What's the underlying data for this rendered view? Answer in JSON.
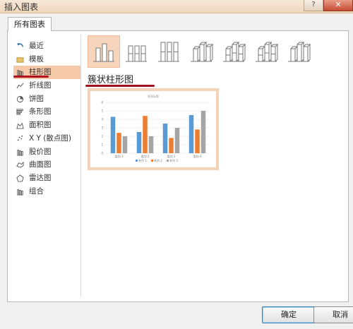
{
  "window": {
    "title": "插入图表",
    "help": "?",
    "close": "✕"
  },
  "tab_label": "所有图表",
  "sidebar": {
    "items": [
      {
        "label": "最近",
        "icon": "undo-icon"
      },
      {
        "label": "模板",
        "icon": "folder-icon"
      },
      {
        "label": "柱形图",
        "icon": "column-chart-icon",
        "selected": true
      },
      {
        "label": "折线图",
        "icon": "line-chart-icon"
      },
      {
        "label": "饼图",
        "icon": "pie-chart-icon"
      },
      {
        "label": "条形图",
        "icon": "bar-chart-icon"
      },
      {
        "label": "面积图",
        "icon": "area-chart-icon"
      },
      {
        "label": "X Y (散点图)",
        "icon": "scatter-chart-icon"
      },
      {
        "label": "股价图",
        "icon": "stock-chart-icon"
      },
      {
        "label": "曲面图",
        "icon": "surface-chart-icon"
      },
      {
        "label": "雷达图",
        "icon": "radar-chart-icon"
      },
      {
        "label": "组合",
        "icon": "combo-chart-icon"
      }
    ]
  },
  "subtypes": [
    {
      "icon": "clustered-column-icon",
      "selected": true
    },
    {
      "icon": "stacked-column-icon"
    },
    {
      "icon": "100-stacked-column-icon"
    },
    {
      "icon": "3d-clustered-column-icon"
    },
    {
      "icon": "3d-stacked-column-icon"
    },
    {
      "icon": "3d-100-stacked-column-icon"
    },
    {
      "icon": "3d-column-icon"
    }
  ],
  "subtype_name": "簇状柱形图",
  "chart_data": {
    "type": "bar",
    "title": "图表标题",
    "categories": [
      "类别 1",
      "类别 2",
      "类别 3",
      "类别 4"
    ],
    "series": [
      {
        "name": "系列 1",
        "values": [
          4.3,
          2.5,
          3.5,
          4.5
        ],
        "color": "#5b9bd5"
      },
      {
        "name": "系列 2",
        "values": [
          2.4,
          4.4,
          1.8,
          2.8
        ],
        "color": "#ed7d31"
      },
      {
        "name": "系列 3",
        "values": [
          2,
          2,
          3,
          5
        ],
        "color": "#a5a5a5"
      }
    ],
    "yticks": [
      "0",
      "1",
      "2",
      "3",
      "4",
      "5",
      "6"
    ],
    "ylim": [
      0,
      6
    ],
    "grid": true,
    "legend": "bottom"
  },
  "buttons": {
    "ok": "确定",
    "cancel": "取消"
  }
}
